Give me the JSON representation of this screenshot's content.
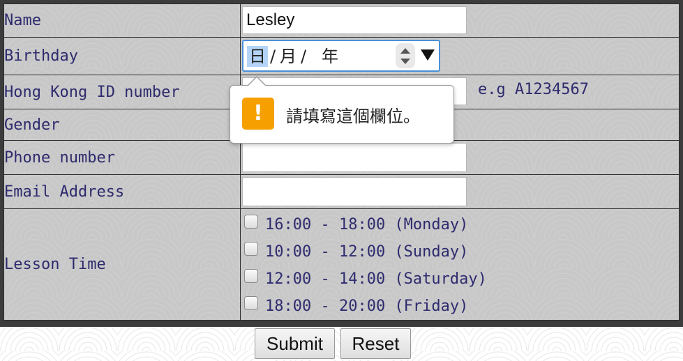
{
  "form": {
    "rows": {
      "name": {
        "label": "Name",
        "value": "Lesley"
      },
      "birthday": {
        "label": "Birthday",
        "day": "日",
        "sep1": "/",
        "month": "月",
        "sep2": "/",
        "year": "年"
      },
      "hkid": {
        "label": "Hong Kong ID number",
        "hint": "e.g A1234567"
      },
      "gender": {
        "label": "Gender"
      },
      "phone": {
        "label": "Phone number"
      },
      "email": {
        "label": "Email Address"
      },
      "lesson": {
        "label": "Lesson Time",
        "options": [
          {
            "text": "16:00 - 18:00 (Monday)",
            "checked": false
          },
          {
            "text": "10:00 - 12:00 (Sunday)",
            "checked": false
          },
          {
            "text": "12:00 - 14:00 (Saturday)",
            "checked": false
          },
          {
            "text": "18:00 - 20:00 (Friday)",
            "checked": false
          }
        ]
      }
    }
  },
  "buttons": {
    "submit": "Submit",
    "reset": "Reset"
  },
  "tooltip": {
    "icon": "!",
    "message": "請填寫這個欄位。"
  },
  "colors": {
    "label": "#2e2b6e",
    "warning": "#f5a000",
    "focus": "#4a90d9"
  }
}
